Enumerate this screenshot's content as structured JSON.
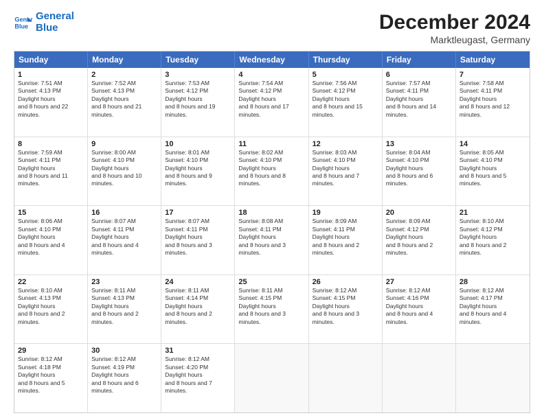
{
  "logo": {
    "line1": "General",
    "line2": "Blue"
  },
  "title": "December 2024",
  "subtitle": "Marktleugast, Germany",
  "days": [
    "Sunday",
    "Monday",
    "Tuesday",
    "Wednesday",
    "Thursday",
    "Friday",
    "Saturday"
  ],
  "weeks": [
    [
      {
        "day": 1,
        "rise": "7:51 AM",
        "set": "4:13 PM",
        "light": "8 hours and 22 minutes."
      },
      {
        "day": 2,
        "rise": "7:52 AM",
        "set": "4:13 PM",
        "light": "8 hours and 21 minutes."
      },
      {
        "day": 3,
        "rise": "7:53 AM",
        "set": "4:12 PM",
        "light": "8 hours and 19 minutes."
      },
      {
        "day": 4,
        "rise": "7:54 AM",
        "set": "4:12 PM",
        "light": "8 hours and 17 minutes."
      },
      {
        "day": 5,
        "rise": "7:56 AM",
        "set": "4:12 PM",
        "light": "8 hours and 15 minutes."
      },
      {
        "day": 6,
        "rise": "7:57 AM",
        "set": "4:11 PM",
        "light": "8 hours and 14 minutes."
      },
      {
        "day": 7,
        "rise": "7:58 AM",
        "set": "4:11 PM",
        "light": "8 hours and 12 minutes."
      }
    ],
    [
      {
        "day": 8,
        "rise": "7:59 AM",
        "set": "4:11 PM",
        "light": "8 hours and 11 minutes."
      },
      {
        "day": 9,
        "rise": "8:00 AM",
        "set": "4:10 PM",
        "light": "8 hours and 10 minutes."
      },
      {
        "day": 10,
        "rise": "8:01 AM",
        "set": "4:10 PM",
        "light": "8 hours and 9 minutes."
      },
      {
        "day": 11,
        "rise": "8:02 AM",
        "set": "4:10 PM",
        "light": "8 hours and 8 minutes."
      },
      {
        "day": 12,
        "rise": "8:03 AM",
        "set": "4:10 PM",
        "light": "8 hours and 7 minutes."
      },
      {
        "day": 13,
        "rise": "8:04 AM",
        "set": "4:10 PM",
        "light": "8 hours and 6 minutes."
      },
      {
        "day": 14,
        "rise": "8:05 AM",
        "set": "4:10 PM",
        "light": "8 hours and 5 minutes."
      }
    ],
    [
      {
        "day": 15,
        "rise": "8:06 AM",
        "set": "4:10 PM",
        "light": "8 hours and 4 minutes."
      },
      {
        "day": 16,
        "rise": "8:07 AM",
        "set": "4:11 PM",
        "light": "8 hours and 4 minutes."
      },
      {
        "day": 17,
        "rise": "8:07 AM",
        "set": "4:11 PM",
        "light": "8 hours and 3 minutes."
      },
      {
        "day": 18,
        "rise": "8:08 AM",
        "set": "4:11 PM",
        "light": "8 hours and 3 minutes."
      },
      {
        "day": 19,
        "rise": "8:09 AM",
        "set": "4:11 PM",
        "light": "8 hours and 2 minutes."
      },
      {
        "day": 20,
        "rise": "8:09 AM",
        "set": "4:12 PM",
        "light": "8 hours and 2 minutes."
      },
      {
        "day": 21,
        "rise": "8:10 AM",
        "set": "4:12 PM",
        "light": "8 hours and 2 minutes."
      }
    ],
    [
      {
        "day": 22,
        "rise": "8:10 AM",
        "set": "4:13 PM",
        "light": "8 hours and 2 minutes."
      },
      {
        "day": 23,
        "rise": "8:11 AM",
        "set": "4:13 PM",
        "light": "8 hours and 2 minutes."
      },
      {
        "day": 24,
        "rise": "8:11 AM",
        "set": "4:14 PM",
        "light": "8 hours and 2 minutes."
      },
      {
        "day": 25,
        "rise": "8:11 AM",
        "set": "4:15 PM",
        "light": "8 hours and 3 minutes."
      },
      {
        "day": 26,
        "rise": "8:12 AM",
        "set": "4:15 PM",
        "light": "8 hours and 3 minutes."
      },
      {
        "day": 27,
        "rise": "8:12 AM",
        "set": "4:16 PM",
        "light": "8 hours and 4 minutes."
      },
      {
        "day": 28,
        "rise": "8:12 AM",
        "set": "4:17 PM",
        "light": "8 hours and 4 minutes."
      }
    ],
    [
      {
        "day": 29,
        "rise": "8:12 AM",
        "set": "4:18 PM",
        "light": "8 hours and 5 minutes."
      },
      {
        "day": 30,
        "rise": "8:12 AM",
        "set": "4:19 PM",
        "light": "8 hours and 6 minutes."
      },
      {
        "day": 31,
        "rise": "8:12 AM",
        "set": "4:20 PM",
        "light": "8 hours and 7 minutes."
      },
      null,
      null,
      null,
      null
    ]
  ]
}
